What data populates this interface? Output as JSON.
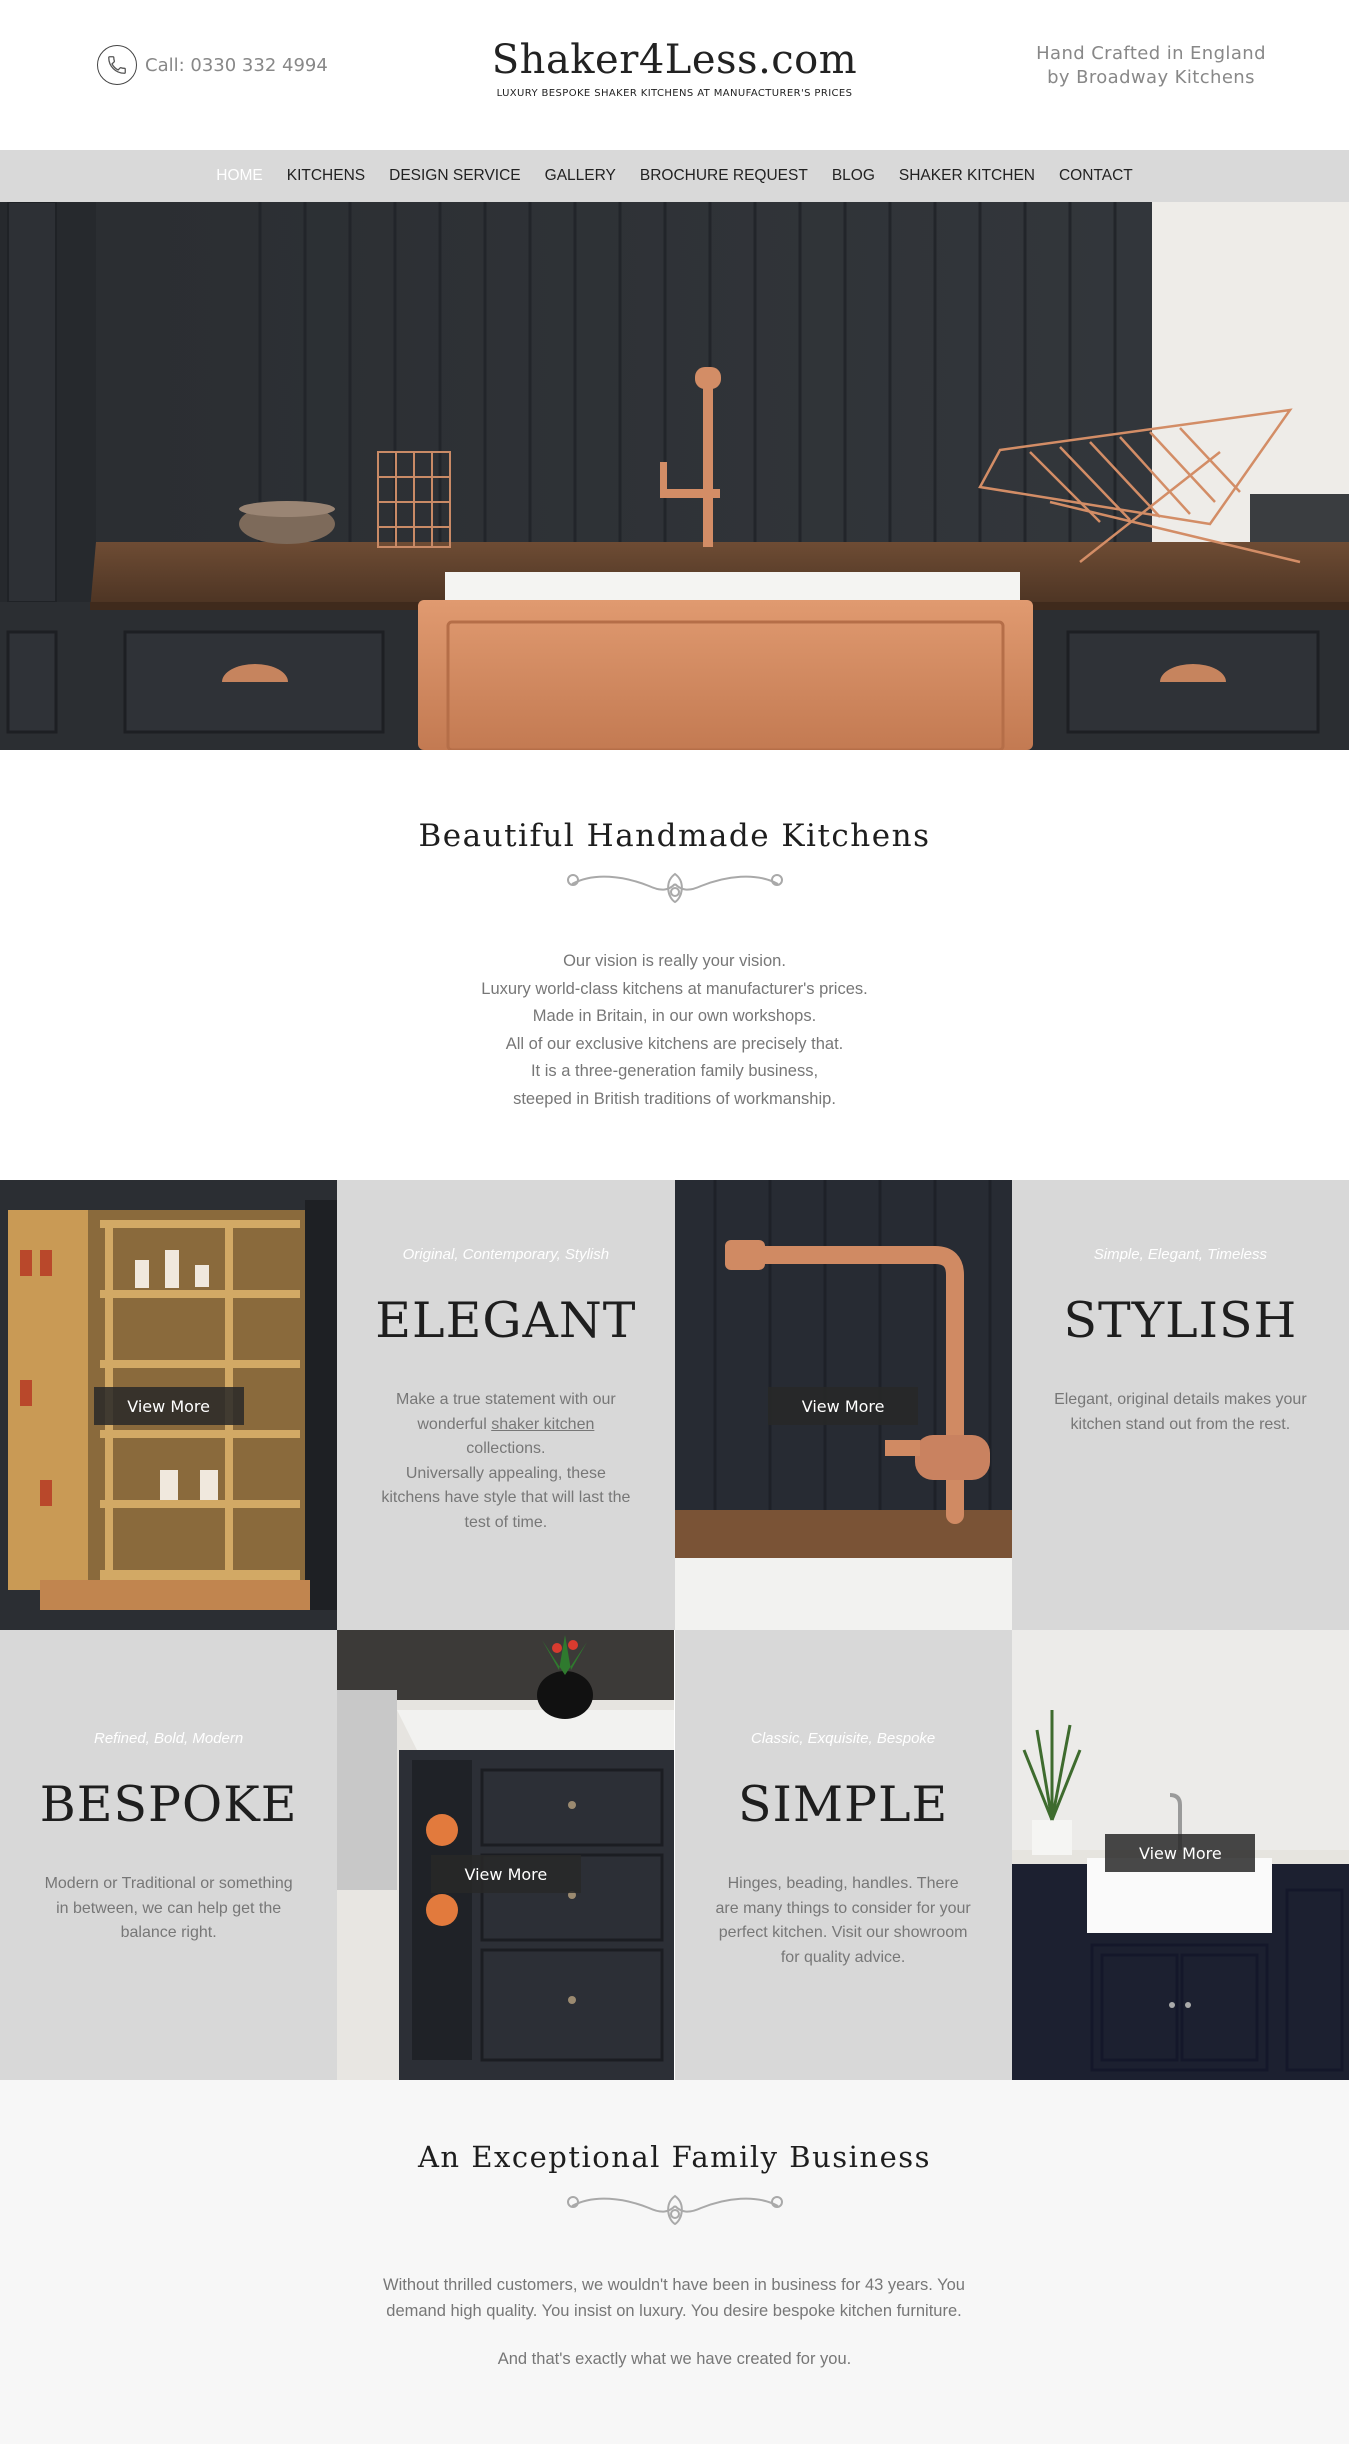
{
  "header": {
    "phone_label": "Call: 0330 332 4994",
    "logo_title": "Shaker4Less.com",
    "logo_tagline": "LUXURY BESPOKE SHAKER KITCHENS AT MANUFACTURER'S PRICES",
    "craft_line1": "Hand Crafted in England",
    "craft_line2": "by Broadway Kitchens"
  },
  "nav": {
    "items": [
      "HOME",
      "KITCHENS",
      "DESIGN SERVICE",
      "GALLERY",
      "BROCHURE REQUEST",
      "BLOG",
      "SHAKER KITCHEN",
      "CONTACT"
    ],
    "active": "HOME"
  },
  "intro": {
    "title": "Beautiful Handmade Kitchens",
    "lines": [
      "Our vision is really your vision.",
      "Luxury world-class kitchens at manufacturer's prices.",
      "Made in Britain, in our own workshops.",
      "All of our exclusive kitchens are precisely that.",
      "It is a three-generation family business,",
      "steeped in British traditions of workmanship."
    ]
  },
  "grid": {
    "view_more": "View More",
    "elegant": {
      "tag": "Original, Contemporary, Stylish",
      "title": "ELEGANT",
      "text_before": "Make a true statement with our wonderful ",
      "link": "shaker kitchen",
      "text_after": " collections.",
      "text2": "Universally appealing, these kitchens have style that will last the test of time."
    },
    "stylish": {
      "tag": "Simple, Elegant, Timeless",
      "title": "STYLISH",
      "text": "Elegant, original details makes your kitchen stand out from the rest."
    },
    "bespoke": {
      "tag": "Refined, Bold, Modern",
      "title": "BESPOKE",
      "text": "Modern or Traditional or something in between, we can help get the balance right."
    },
    "simple": {
      "tag": "Classic, Exquisite, Bespoke",
      "title": "SIMPLE",
      "text": "Hinges, beading, handles. There are many things to consider for your perfect kitchen. Visit our showroom for quality advice."
    }
  },
  "family": {
    "title": "An Exceptional Family Business",
    "text1": "Without thrilled customers, we wouldn't have been in business for 43 years. You demand high quality. You insist on luxury. You desire bespoke kitchen furniture.",
    "text2": "And that's exactly what we have created for you."
  },
  "colors": {
    "nav_bg": "#d9d9d9",
    "copper": "#d08a63",
    "navy": "#1c2030",
    "slate": "#2c2f33",
    "panel_grey": "#d8d8d8"
  }
}
